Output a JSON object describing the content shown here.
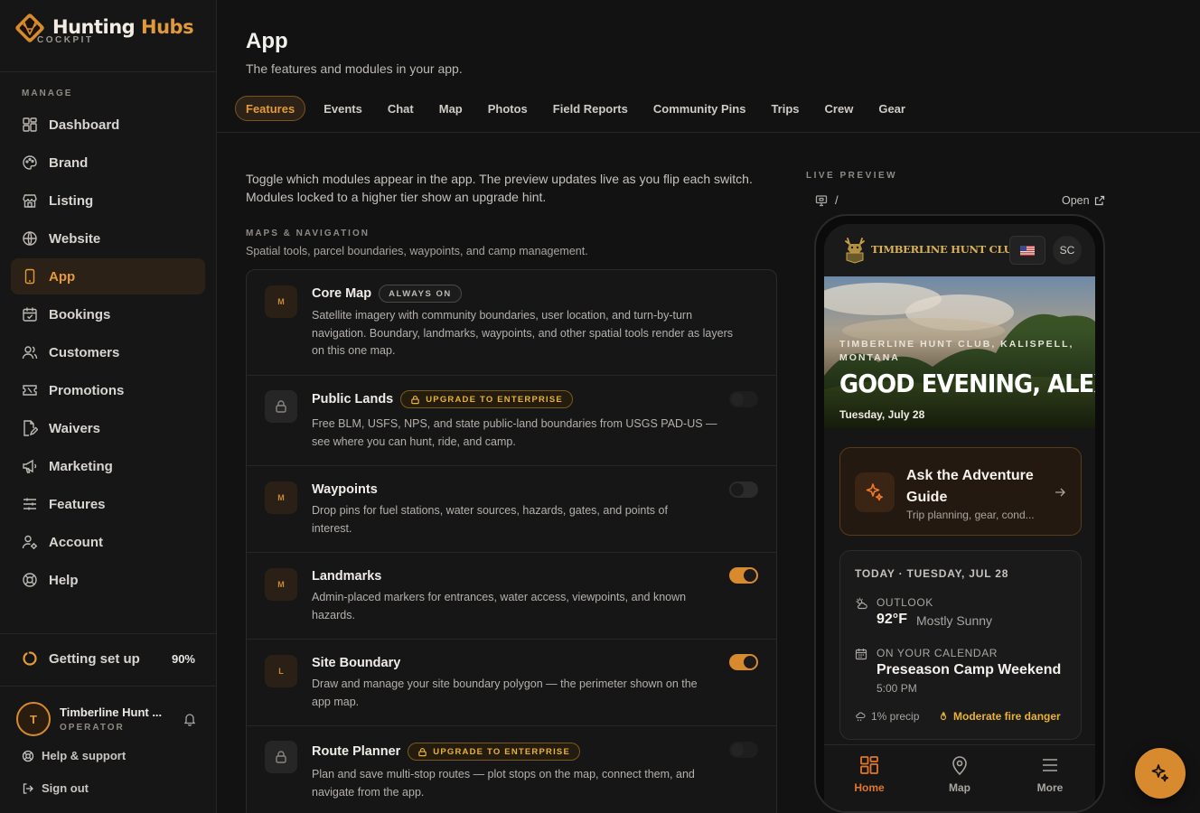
{
  "brand": {
    "name_part1": "Hunting",
    "name_part2": "Hubs",
    "subtitle": "COCKPIT"
  },
  "sidebar": {
    "section_label": "MANAGE",
    "items": [
      {
        "label": "Dashboard",
        "icon": "dashboard-icon"
      },
      {
        "label": "Brand",
        "icon": "palette-icon"
      },
      {
        "label": "Listing",
        "icon": "store-icon"
      },
      {
        "label": "Website",
        "icon": "globe-icon"
      },
      {
        "label": "App",
        "icon": "phone-icon",
        "active": true
      },
      {
        "label": "Bookings",
        "icon": "calendar-icon"
      },
      {
        "label": "Customers",
        "icon": "users-icon"
      },
      {
        "label": "Promotions",
        "icon": "ticket-icon"
      },
      {
        "label": "Waivers",
        "icon": "document-sign-icon"
      },
      {
        "label": "Marketing",
        "icon": "megaphone-icon"
      },
      {
        "label": "Features",
        "icon": "sliders-icon"
      },
      {
        "label": "Account",
        "icon": "user-cog-icon"
      },
      {
        "label": "Help",
        "icon": "lifebuoy-icon"
      }
    ],
    "setup": {
      "label": "Getting set up",
      "percent": "90%",
      "progress": 0.9
    },
    "user": {
      "initial": "T",
      "name": "Timberline Hunt ...",
      "role": "OPERATOR"
    },
    "help_support": "Help & support",
    "sign_out": "Sign out"
  },
  "header": {
    "title": "App",
    "subtitle": "The features and modules in your app.",
    "tabs": [
      "Features",
      "Events",
      "Chat",
      "Map",
      "Photos",
      "Field Reports",
      "Community Pins",
      "Trips",
      "Crew",
      "Gear"
    ],
    "active_tab": "Features"
  },
  "intro": "Toggle which modules appear in the app. The preview updates live as you flip each switch. Modules locked to a higher tier show an upgrade hint.",
  "group": {
    "label": "MAPS & NAVIGATION",
    "subtitle": "Spatial tools, parcel boundaries, waypoints, and camp management."
  },
  "modules": [
    {
      "icon_letter": "M",
      "title": "Core Map",
      "badge": "ALWAYS ON",
      "badge_type": "always",
      "desc": "Satellite imagery with community boundaries, user location, and turn-by-turn navigation. Boundary, landmarks, waypoints, and other spatial tools render as layers on this one map.",
      "toggle": "none"
    },
    {
      "icon_letter": "",
      "locked": true,
      "title": "Public Lands",
      "badge": "UPGRADE TO ENTERPRISE",
      "badge_type": "upgrade",
      "desc": "Free BLM, USFS, NPS, and state public-land boundaries from USGS PAD-US — see where you can hunt, ride, and camp.",
      "toggle": "dim"
    },
    {
      "icon_letter": "M",
      "title": "Waypoints",
      "badge": "",
      "desc": "Drop pins for fuel stations, water sources, hazards, gates, and points of interest.",
      "toggle": "off"
    },
    {
      "icon_letter": "M",
      "title": "Landmarks",
      "badge": "",
      "desc": "Admin-placed markers for entrances, water access, viewpoints, and known hazards.",
      "toggle": "on"
    },
    {
      "icon_letter": "L",
      "title": "Site Boundary",
      "badge": "",
      "desc": "Draw and manage your site boundary polygon — the perimeter shown on the app map.",
      "toggle": "on"
    },
    {
      "icon_letter": "",
      "locked": true,
      "title": "Route Planner",
      "badge": "UPGRADE TO ENTERPRISE",
      "badge_type": "upgrade",
      "desc": "Plan and save multi-stop routes — plot stops on the map, connect them, and navigate from the app.",
      "toggle": "dim"
    }
  ],
  "preview": {
    "label": "LIVE PREVIEW",
    "path": "/",
    "open_label": "Open",
    "club_name": "TIMBERLINE HUNT CLUB",
    "user_initials": "SC",
    "location": "TIMBERLINE HUNT CLUB, KALISPELL, MONTANA",
    "greeting": "GOOD EVENING, ALEX",
    "date": "Tuesday, July 28",
    "ask_title": "Ask the Adventure Guide",
    "ask_sub": "Trip planning, gear, cond...",
    "today_head": "TODAY · TUESDAY, JUL 28",
    "outlook_label": "OUTLOOK",
    "temp": "92°F",
    "condition": "Mostly Sunny",
    "calendar_label": "ON YOUR CALENDAR",
    "event_name": "Preseason Camp Weekend",
    "event_time": "5:00 PM",
    "precip": "1% precip",
    "fire": "Moderate fire danger",
    "nav": [
      "Home",
      "Map",
      "More"
    ]
  },
  "colors": {
    "accent": "#d88a2e",
    "accent_text": "#e59a3a",
    "warning": "#e8b23a",
    "background": "#121212"
  }
}
